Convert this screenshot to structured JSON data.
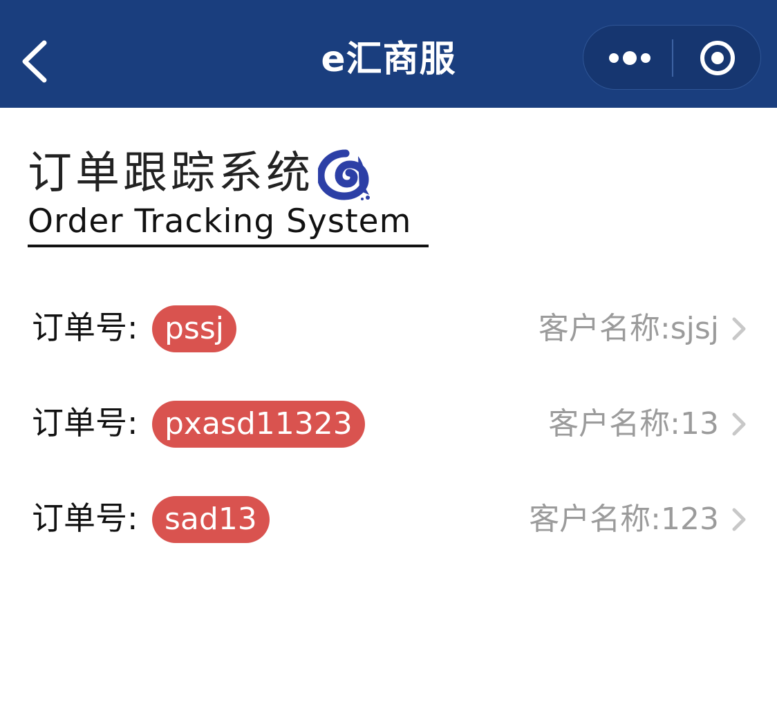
{
  "navbar": {
    "title": "e汇商服",
    "background": "#1a3e7e",
    "back_icon": "chevron-left-icon",
    "more_icon": "more-dots-icon",
    "close_icon": "target-circle-icon"
  },
  "logo": {
    "title_cn": "订单跟踪系统",
    "title_en": "Order Tracking System",
    "mark_icon": "swirl-logo-icon",
    "mark_color": "#2c3fa6"
  },
  "orders": [
    {
      "label": "订单号:",
      "order_no": "pssj",
      "customer": "客户名称:sjsj"
    },
    {
      "label": "订单号:",
      "order_no": "pxasd11323",
      "customer": "客户名称:13"
    },
    {
      "label": "订单号:",
      "order_no": "sad13",
      "customer": "客户名称:123"
    }
  ],
  "colors": {
    "badge": "#d9534f",
    "customer_text": "#9b9b9b",
    "chevron": "#c8c8c8"
  }
}
